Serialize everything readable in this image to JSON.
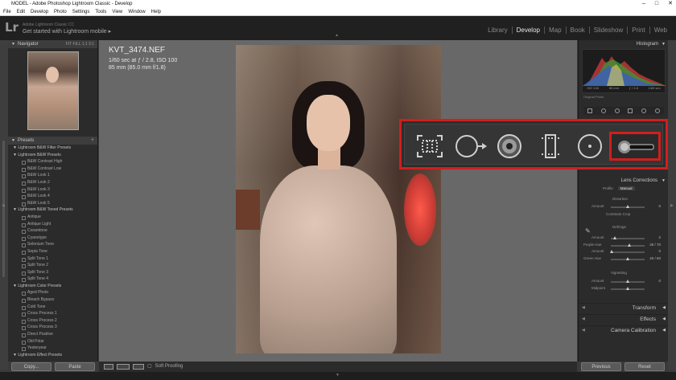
{
  "window": {
    "title": "MODEL - Adobe Photoshop Lightroom Classic - Develop",
    "controls": [
      "–",
      "□",
      "✕"
    ]
  },
  "menu": [
    "File",
    "Edit",
    "Develop",
    "Photo",
    "Settings",
    "Tools",
    "View",
    "Window",
    "Help"
  ],
  "identity": {
    "logo": "Lr",
    "product": "Adobe Lightroom Classic CC",
    "tagline": "Get started with Lightroom mobile ▸"
  },
  "modules": [
    "Library",
    "Develop",
    "Map",
    "Book",
    "Slideshow",
    "Print",
    "Web"
  ],
  "navigator": {
    "title": "Navigator",
    "options": "FIT  FILL  1:1  3:1"
  },
  "presets": {
    "title": "Presets",
    "groups": [
      {
        "name": "Lightroom B&W Filter Presets",
        "items": []
      },
      {
        "name": "Lightroom B&W Presets",
        "items": [
          "B&W Contrast High",
          "B&W Contrast Low",
          "B&W Look 1",
          "B&W Look 2",
          "B&W Look 3",
          "B&W Look 4",
          "B&W Look 5"
        ]
      },
      {
        "name": "Lightroom B&W Toned Presets",
        "items": [
          "Antique",
          "Antique Light",
          "Creamtone",
          "Cyanotype",
          "Selenium Tone",
          "Sepia Tone",
          "Split Tone 1",
          "Split Tone 2",
          "Split Tone 3",
          "Split Tone 4"
        ]
      },
      {
        "name": "Lightroom Color Presets",
        "items": [
          "Aged Photo",
          "Bleach Bypass",
          "Cold Tone",
          "Cross Process 1",
          "Cross Process 2",
          "Cross Process 3",
          "Direct Positive",
          "Old Polar",
          "Yesteryear"
        ]
      },
      {
        "name": "Lightroom Effect Presets",
        "items": []
      }
    ]
  },
  "left_buttons": {
    "copy": "Copy...",
    "paste": "Paste"
  },
  "photo_info": {
    "filename": "KVT_3474.NEF",
    "exposure": "1/60 sec at ƒ / 2.8, ISO 100",
    "lens": "85 mm (85.0 mm f/1.8)"
  },
  "toolbar": {
    "soft_proofing": "Soft Proofing"
  },
  "histogram": {
    "title": "Histogram",
    "info": [
      "ISO 100",
      "85 mm",
      "ƒ / 2.8",
      "1/60 sec"
    ],
    "original_photo": "Original Photo"
  },
  "lens_corrections": {
    "title": "Lens Corrections",
    "tabs": [
      "Profile",
      "Manual"
    ],
    "active_tab": "Manual",
    "distortion": {
      "title": "Distortion",
      "amount_label": "Amount",
      "amount_value": "0",
      "amount_level": 0.5,
      "constrain_crop": "Constrain Crop"
    },
    "defringe": {
      "title": "Defringe",
      "rows": [
        {
          "label": "Amount",
          "value": "2",
          "level": 0.12
        },
        {
          "label": "Purple Hue",
          "value": "30 / 70",
          "level": 0.55
        },
        {
          "label": "Amount",
          "value": "0",
          "level": 0.02
        },
        {
          "label": "Green Hue",
          "value": "40 / 60",
          "level": 0.5
        }
      ]
    },
    "vignetting": {
      "title": "Vignetting",
      "rows": [
        {
          "label": "Amount",
          "value": "0",
          "level": 0.5
        },
        {
          "label": "Midpoint",
          "value": "",
          "level": 0.5
        }
      ]
    }
  },
  "bottom_panels": [
    "Transform",
    "Effects",
    "Camera Calibration"
  ],
  "right_buttons": {
    "previous": "Previous",
    "reset": "Reset"
  },
  "colors": {
    "highlight": "#d01e1e",
    "panel": "#2b2b2b",
    "canvas": "#686868"
  },
  "callout_tools": [
    "crop-overlay-icon",
    "spot-removal-icon",
    "red-eye-icon",
    "graduated-filter-icon",
    "radial-filter-icon",
    "adjustment-brush-icon"
  ]
}
